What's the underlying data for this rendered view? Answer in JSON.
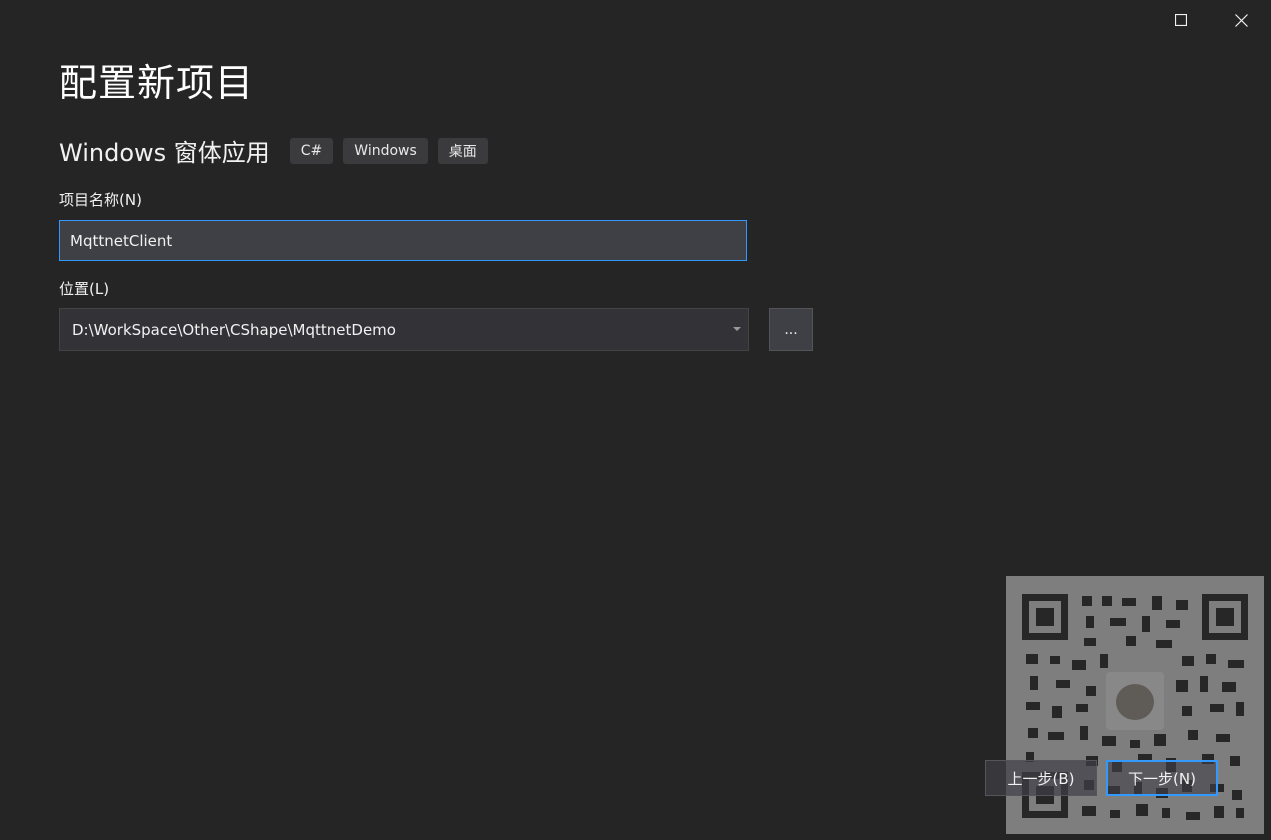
{
  "window": {
    "maximize_icon": "maximize-icon",
    "close_icon": "close-icon"
  },
  "page": {
    "title": "配置新项目"
  },
  "template": {
    "name": "Windows 窗体应用",
    "tags": [
      "C#",
      "Windows",
      "桌面"
    ]
  },
  "project_name": {
    "label": "项目名称(N)",
    "value": "MqttnetClient"
  },
  "location": {
    "label": "位置(L)",
    "value": "D:\\WorkSpace\\Other\\CShape\\MqttnetDemo",
    "browse_label": "..."
  },
  "footer": {
    "back_label": "上一步(B)",
    "next_label": "下一步(N)"
  },
  "colors": {
    "background": "#252526",
    "accent": "#3399ff",
    "input_bg": "#3f3f46"
  }
}
